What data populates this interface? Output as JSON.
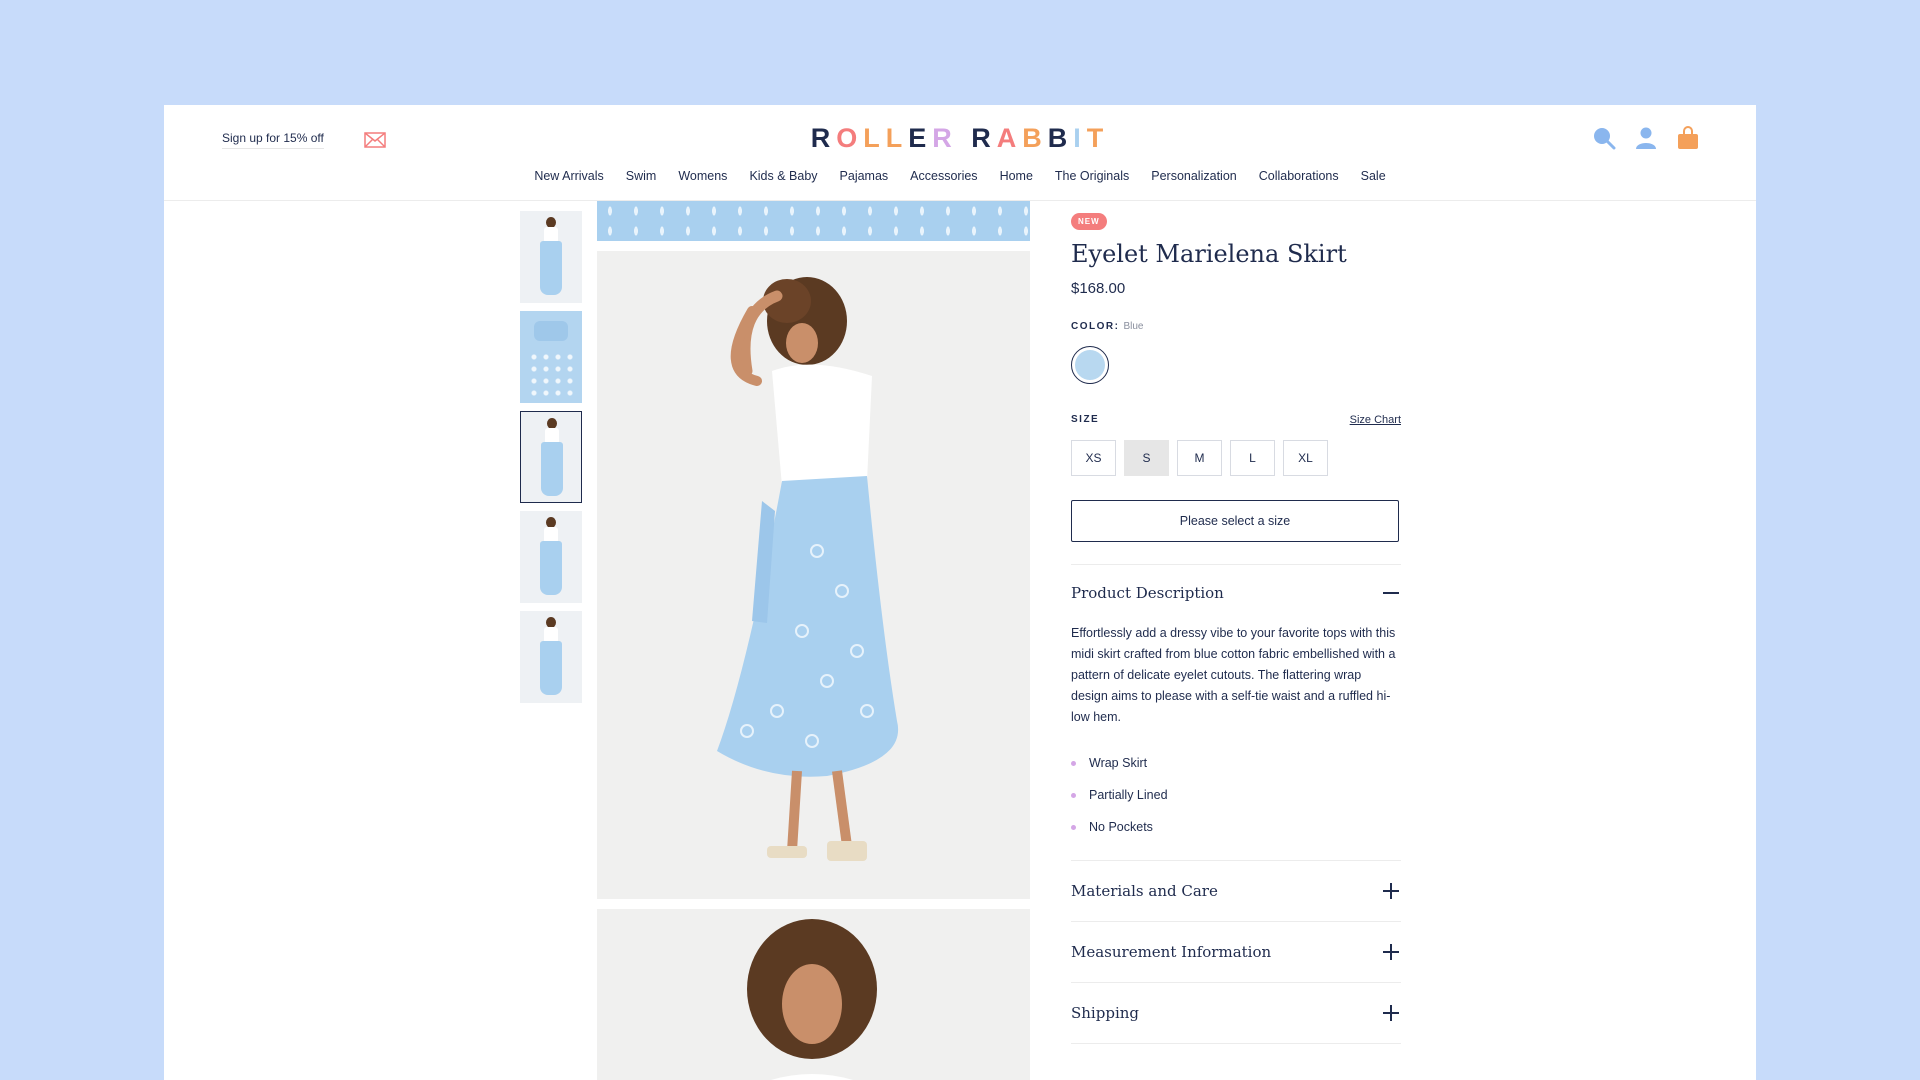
{
  "header": {
    "signup_text": "Sign up for 15% off",
    "logo_letters": [
      {
        "ch": "R",
        "color": "#1f2b4d"
      },
      {
        "ch": "O",
        "color": "#f47d7d"
      },
      {
        "ch": "L",
        "color": "#f4a05a"
      },
      {
        "ch": "L",
        "color": "#f4a05a"
      },
      {
        "ch": "E",
        "color": "#1f2b4d"
      },
      {
        "ch": "R",
        "color": "#d4a6e6"
      },
      {
        "ch": " ",
        "color": "#1f2b4d"
      },
      {
        "ch": "R",
        "color": "#1f2b4d"
      },
      {
        "ch": "A",
        "color": "#f47d7d"
      },
      {
        "ch": "B",
        "color": "#f4a05a"
      },
      {
        "ch": "B",
        "color": "#1f2b4d"
      },
      {
        "ch": "I",
        "color": "#a9d0ef"
      },
      {
        "ch": "T",
        "color": "#f4a05a"
      }
    ],
    "logo_alt": "ROLLER RABBIT",
    "nav": [
      "New Arrivals",
      "Swim",
      "Womens",
      "Kids & Baby",
      "Pajamas",
      "Accessories",
      "Home",
      "The Originals",
      "Personalization",
      "Collaborations",
      "Sale"
    ]
  },
  "product": {
    "badge": "NEW",
    "title": "Eyelet Marielena Skirt",
    "price": "$168.00",
    "color_label": "COLOR:",
    "color_value": "Blue",
    "size_label": "SIZE",
    "size_chart": "Size Chart",
    "sizes": [
      "XS",
      "S",
      "M",
      "L",
      "XL"
    ],
    "selected_size": "S",
    "cta": "Please select a size"
  },
  "accordions": {
    "description": {
      "title": "Product Description",
      "text": "Effortlessly add a dressy vibe to your favorite tops with this midi skirt crafted from blue cotton fabric embellished with a pattern of delicate eyelet cutouts. The flattering wrap design aims to please with a self-tie waist and a ruffled hi-low hem.",
      "bullets": [
        "Wrap Skirt",
        "Partially Lined",
        "No Pockets"
      ]
    },
    "materials": "Materials and Care",
    "measurement": "Measurement Information",
    "shipping": "Shipping"
  },
  "colors": {
    "navy": "#1f2b4d",
    "page_bg": "#c7dbfa",
    "badge": "#f47d7d",
    "icon_blue": "#8ab6ee",
    "icon_orange": "#f4a05a"
  }
}
